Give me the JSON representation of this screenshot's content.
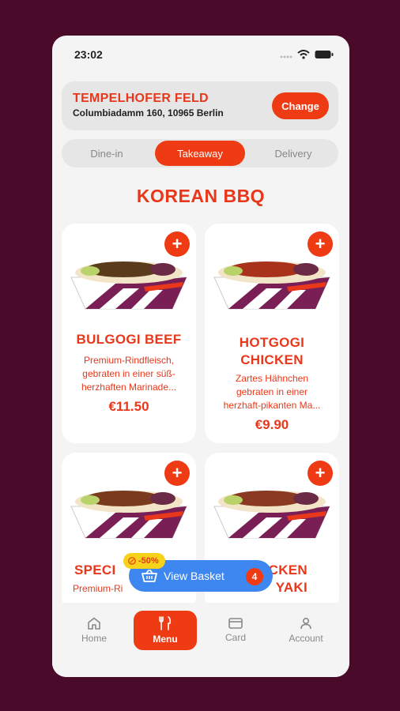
{
  "status": {
    "time": "23:02"
  },
  "location": {
    "title": "TEMPELHOFER FELD",
    "address": "Columbiadamm 160, 10965 Berlin",
    "change_label": "Change"
  },
  "order_modes": [
    {
      "label": "Dine-in",
      "active": false
    },
    {
      "label": "Takeaway",
      "active": true
    },
    {
      "label": "Delivery",
      "active": false
    }
  ],
  "section_title": "KOREAN BBQ",
  "products": [
    {
      "name_l1": "BULGOGI BEEF",
      "name_l2": "",
      "desc_l1": "Premium-Rindfleisch,",
      "desc_l2": "gebraten in einer süß-",
      "desc_l3": "herzhaften Marinade...",
      "price": "€11.50"
    },
    {
      "name_l1": "HOTGOGI",
      "name_l2": "CHICKEN",
      "desc_l1": "Zartes Hähnchen",
      "desc_l2": "gebraten in einer",
      "desc_l3": "herzhaft-pikanten Ma...",
      "price": "€9.90"
    },
    {
      "name_l1": "SPECI",
      "desc_l1": "Premium-Ri"
    },
    {
      "name_l1": "CKEN",
      "name_l2": "YAKI"
    }
  ],
  "basket": {
    "label": "View Basket",
    "count": "4",
    "discount": "-50%"
  },
  "tabs": [
    {
      "label": "Home",
      "icon": "home-icon"
    },
    {
      "label": "Menu",
      "icon": "cutlery-icon"
    },
    {
      "label": "Card",
      "icon": "card-icon"
    },
    {
      "label": "Account",
      "icon": "account-icon"
    }
  ],
  "colors": {
    "accent": "#ee3b14",
    "text_accent": "#e8371a",
    "basket": "#3f87f0",
    "badge": "#f7d21a",
    "backdrop": "#4a0a2a"
  }
}
